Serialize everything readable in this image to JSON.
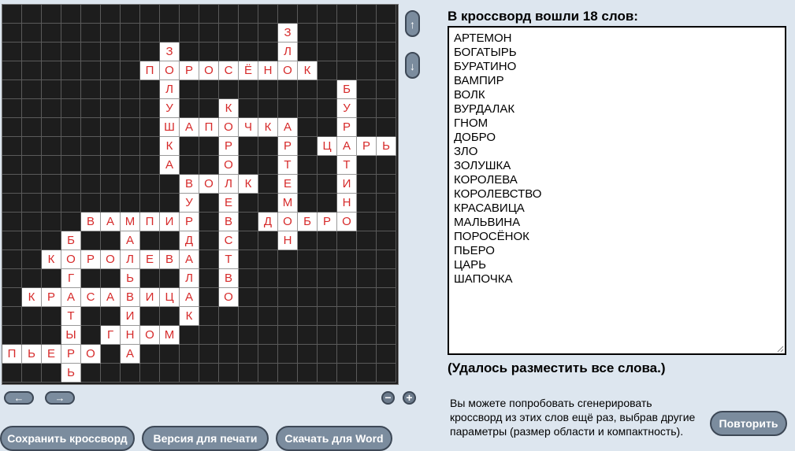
{
  "grid": {
    "cols": 20,
    "rows": 20,
    "cells": [
      [
        1,
        14,
        "З"
      ],
      [
        2,
        8,
        "З"
      ],
      [
        2,
        14,
        "Л"
      ],
      [
        3,
        7,
        "П"
      ],
      [
        3,
        8,
        "О"
      ],
      [
        3,
        9,
        "Р"
      ],
      [
        3,
        10,
        "О"
      ],
      [
        3,
        11,
        "С"
      ],
      [
        3,
        12,
        "Ё"
      ],
      [
        3,
        13,
        "Н"
      ],
      [
        3,
        14,
        "О"
      ],
      [
        3,
        15,
        "К"
      ],
      [
        4,
        8,
        "Л"
      ],
      [
        4,
        17,
        "Б"
      ],
      [
        5,
        8,
        "У"
      ],
      [
        5,
        11,
        "К"
      ],
      [
        5,
        17,
        "У"
      ],
      [
        6,
        8,
        "Ш"
      ],
      [
        6,
        9,
        "А"
      ],
      [
        6,
        10,
        "П"
      ],
      [
        6,
        11,
        "О"
      ],
      [
        6,
        12,
        "Ч"
      ],
      [
        6,
        13,
        "К"
      ],
      [
        6,
        14,
        "А"
      ],
      [
        6,
        17,
        "Р"
      ],
      [
        7,
        8,
        "К"
      ],
      [
        7,
        11,
        "Р"
      ],
      [
        7,
        14,
        "Р"
      ],
      [
        7,
        16,
        "Ц"
      ],
      [
        7,
        17,
        "А"
      ],
      [
        7,
        18,
        "Р"
      ],
      [
        7,
        19,
        "Ь"
      ],
      [
        8,
        8,
        "А"
      ],
      [
        8,
        11,
        "О"
      ],
      [
        8,
        14,
        "Т"
      ],
      [
        8,
        17,
        "Т"
      ],
      [
        9,
        9,
        "В"
      ],
      [
        9,
        10,
        "О"
      ],
      [
        9,
        11,
        "Л"
      ],
      [
        9,
        12,
        "К"
      ],
      [
        9,
        14,
        "Е"
      ],
      [
        9,
        17,
        "И"
      ],
      [
        10,
        9,
        "У"
      ],
      [
        10,
        11,
        "Е"
      ],
      [
        10,
        14,
        "М"
      ],
      [
        10,
        17,
        "Н"
      ],
      [
        11,
        4,
        "В"
      ],
      [
        11,
        5,
        "А"
      ],
      [
        11,
        6,
        "М"
      ],
      [
        11,
        7,
        "П"
      ],
      [
        11,
        8,
        "И"
      ],
      [
        11,
        9,
        "Р"
      ],
      [
        11,
        11,
        "В"
      ],
      [
        11,
        13,
        "Д"
      ],
      [
        11,
        14,
        "О"
      ],
      [
        11,
        15,
        "Б"
      ],
      [
        11,
        16,
        "Р"
      ],
      [
        11,
        17,
        "О"
      ],
      [
        12,
        3,
        "Б"
      ],
      [
        12,
        6,
        "А"
      ],
      [
        12,
        9,
        "Д"
      ],
      [
        12,
        11,
        "С"
      ],
      [
        12,
        14,
        "Н"
      ],
      [
        13,
        2,
        "К"
      ],
      [
        13,
        3,
        "О"
      ],
      [
        13,
        4,
        "Р"
      ],
      [
        13,
        5,
        "О"
      ],
      [
        13,
        6,
        "Л"
      ],
      [
        13,
        7,
        "Е"
      ],
      [
        13,
        8,
        "В"
      ],
      [
        13,
        9,
        "А"
      ],
      [
        13,
        11,
        "Т"
      ],
      [
        14,
        3,
        "Г"
      ],
      [
        14,
        6,
        "Ь"
      ],
      [
        14,
        9,
        "Л"
      ],
      [
        14,
        11,
        "В"
      ],
      [
        15,
        1,
        "К"
      ],
      [
        15,
        2,
        "Р"
      ],
      [
        15,
        3,
        "А"
      ],
      [
        15,
        4,
        "С"
      ],
      [
        15,
        5,
        "А"
      ],
      [
        15,
        6,
        "В"
      ],
      [
        15,
        7,
        "И"
      ],
      [
        15,
        8,
        "Ц"
      ],
      [
        15,
        9,
        "А"
      ],
      [
        15,
        11,
        "О"
      ],
      [
        16,
        3,
        "Т"
      ],
      [
        16,
        6,
        "И"
      ],
      [
        16,
        9,
        "К"
      ],
      [
        17,
        3,
        "Ы"
      ],
      [
        17,
        5,
        "Г"
      ],
      [
        17,
        6,
        "Н"
      ],
      [
        17,
        7,
        "О"
      ],
      [
        17,
        8,
        "М"
      ],
      [
        18,
        0,
        "П"
      ],
      [
        18,
        1,
        "Ь"
      ],
      [
        18,
        2,
        "Е"
      ],
      [
        18,
        3,
        "Р"
      ],
      [
        18,
        4,
        "О"
      ],
      [
        18,
        6,
        "А"
      ],
      [
        19,
        3,
        "Ь"
      ]
    ]
  },
  "nav": {
    "up": "↑",
    "down": "↓",
    "left": "←",
    "right": "→",
    "zoom_out": "−",
    "zoom_in": "+"
  },
  "buttons": {
    "save": "Сохранить кроссворд",
    "print": "Версия для печати",
    "word": "Скачать для Word",
    "repeat": "Повторить"
  },
  "panel": {
    "heading": "В кроссворд вошли 18 слов:",
    "words": [
      "АРТЕМОН",
      "БОГАТЫРЬ",
      "БУРАТИНО",
      "ВАМПИР",
      "ВОЛК",
      "ВУРДАЛАК",
      "ГНОМ",
      "ДОБРО",
      "ЗЛО",
      "ЗОЛУШКА",
      "КОРОЛЕВА",
      "КОРОЛЕВСТВО",
      "КРАСАВИЦА",
      "МАЛЬВИНА",
      "ПОРОСЁНОК",
      "ПЬЕРО",
      "ЦАРЬ",
      "ШАПОЧКА"
    ],
    "status": "(Удалось разместить все слова.)",
    "hint": "Вы можете попробовать сгенерировать кроссворд из этих слов ещё раз, выбрав другие параметры (размер области и компактность)."
  }
}
